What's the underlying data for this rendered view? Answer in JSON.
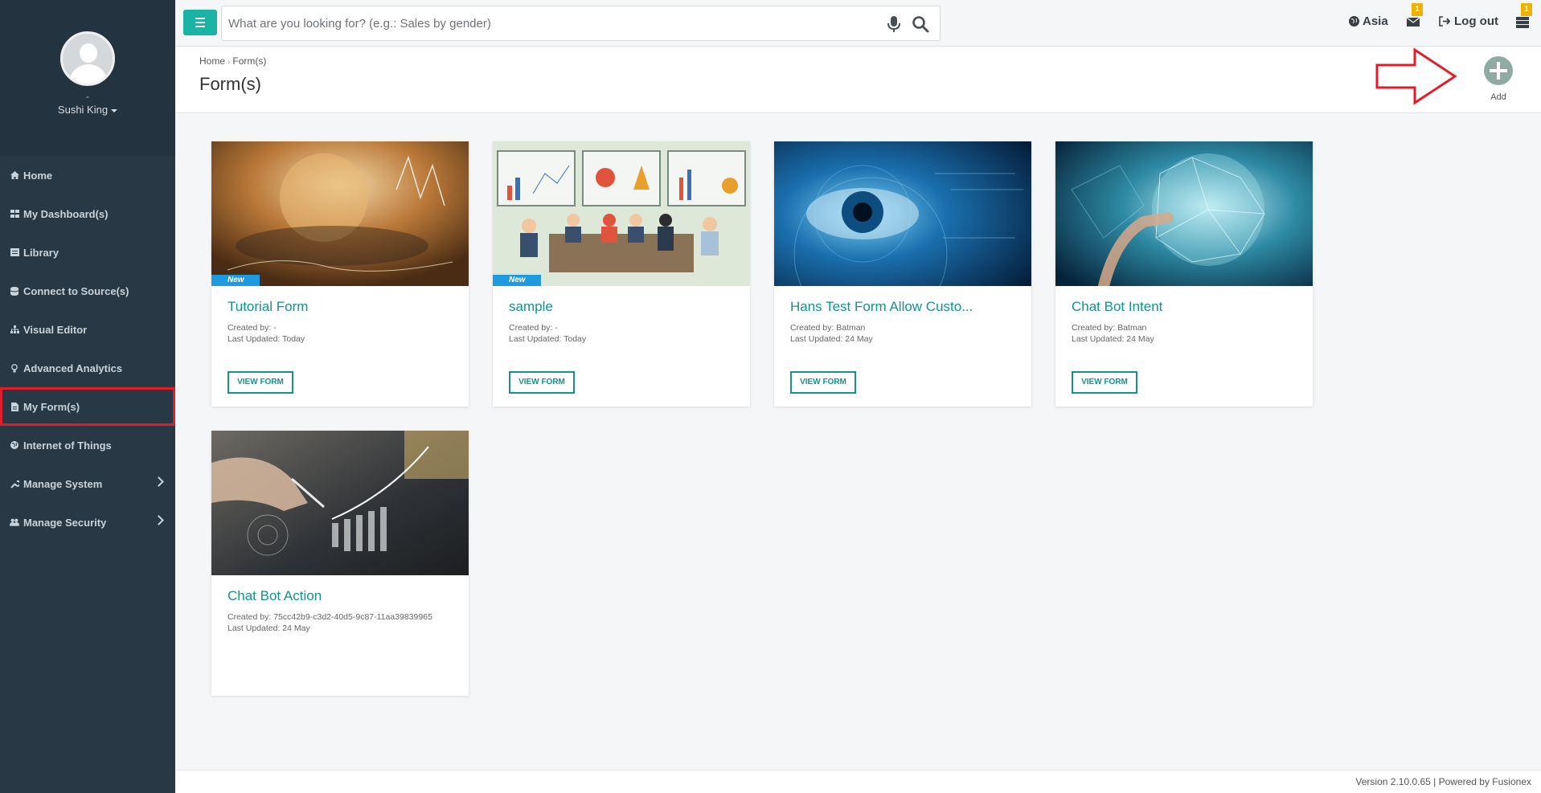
{
  "sidebar": {
    "user_dash": "-",
    "user_name": "Sushi King",
    "items": [
      {
        "label": "Home",
        "icon": "home-icon"
      },
      {
        "label": "My Dashboard(s)",
        "icon": "dashboard-icon"
      },
      {
        "label": "Library",
        "icon": "library-icon"
      },
      {
        "label": "Connect to Source(s)",
        "icon": "database-icon"
      },
      {
        "label": "Visual Editor",
        "icon": "sitemap-icon"
      },
      {
        "label": "Advanced Analytics",
        "icon": "lightbulb-icon"
      },
      {
        "label": "My Form(s)",
        "icon": "file-icon"
      },
      {
        "label": "Internet of Things",
        "icon": "globe-icon"
      },
      {
        "label": "Manage System",
        "icon": "wrench-icon"
      },
      {
        "label": "Manage Security",
        "icon": "users-icon"
      }
    ]
  },
  "topbar": {
    "search_placeholder": "What are you looking for? (e.g.: Sales by gender)",
    "region": "Asia",
    "mail_count": "1",
    "logout": "Log out",
    "server_count": "1"
  },
  "header": {
    "breadcrumb_home": "Home",
    "breadcrumb_current": "Form(s)",
    "title": "Form(s)",
    "add_label": "Add"
  },
  "cards": [
    {
      "title": "Tutorial Form",
      "created": "Created by: -",
      "updated": "Last Updated: Today",
      "badge": "New",
      "button": "VIEW FORM"
    },
    {
      "title": "sample",
      "created": "Created by: -",
      "updated": "Last Updated: Today",
      "badge": "New",
      "button": "VIEW FORM"
    },
    {
      "title": "Hans Test Form Allow Custo...",
      "created": "Created by: Batman",
      "updated": "Last Updated: 24 May",
      "button": "VIEW FORM"
    },
    {
      "title": "Chat Bot Intent",
      "created": "Created by: Batman",
      "updated": "Last Updated: 24 May",
      "button": "VIEW FORM"
    },
    {
      "title": "Chat Bot Action",
      "created": "Created by: 75cc42b9-c3d2-40d5-9c87-11aa39839965",
      "updated": "Last Updated: 24 May"
    }
  ],
  "footer": {
    "text": "Version 2.10.0.65 | Powered by Fusionex"
  },
  "colors": {
    "sidebar_bg": "#283845",
    "accent_teal": "#14928b",
    "menu_button": "#1bb3a4",
    "badge_new": "#1e9be0",
    "highlight_red": "#e11d2a",
    "notification_badge": "#f0b100"
  }
}
